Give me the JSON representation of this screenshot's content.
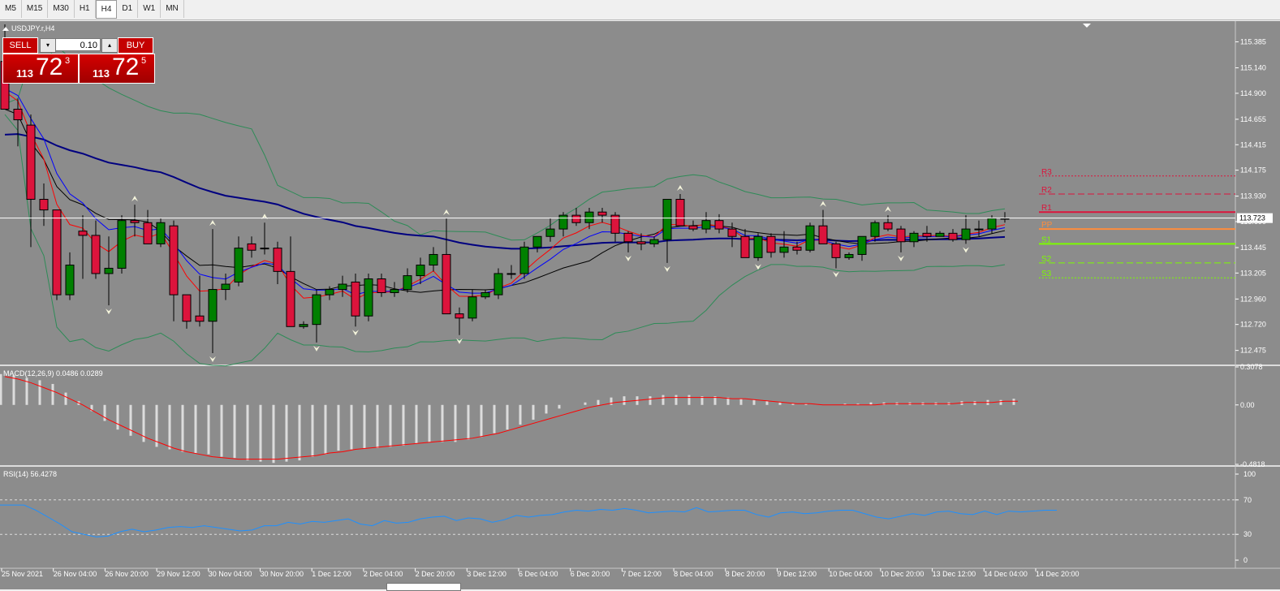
{
  "timeframes": [
    "M5",
    "M15",
    "M30",
    "H1",
    "H4",
    "D1",
    "W1",
    "MN"
  ],
  "active_timeframe": "H4",
  "symbol_label": "USDJPY.r,H4",
  "trade_panel": {
    "sell_label": "SELL",
    "buy_label": "BUY",
    "lot_value": "0.10",
    "sell_price_big": "113",
    "sell_price_pips": "72",
    "sell_price_frac": "3",
    "buy_price_big": "113",
    "buy_price_pips": "72",
    "buy_price_frac": "5"
  },
  "colors": {
    "background": "#8c8c8c",
    "bull": "#008000",
    "bear": "#dc143c",
    "ma_long": "#000080",
    "ma_mid": "#000000",
    "ma_fast_red": "#ff0000",
    "ma_fast_blue": "#0000ff",
    "bollinger": "#2e8b57",
    "macd_signal": "#ff0000",
    "rsi_line": "#1e90ff"
  },
  "chart_data": [
    {
      "type": "candlestick",
      "title": "USDJPY.r,H4",
      "ylim": [
        112.35,
        115.55
      ],
      "y_ticks": [
        "115.385",
        "115.140",
        "114.900",
        "114.655",
        "114.415",
        "114.175",
        "113.930",
        "113.690",
        "113.445",
        "113.205",
        "112.960",
        "112.720",
        "112.475"
      ],
      "current_price": "113.723",
      "x_tick_labels": [
        "25 Nov 2021",
        "26 Nov 04:00",
        "26 Nov 20:00",
        "29 Nov 12:00",
        "30 Nov 04:00",
        "30 Nov 20:00",
        "1 Dec 12:00",
        "2 Dec 04:00",
        "2 Dec 20:00",
        "3 Dec 12:00",
        "6 Dec 04:00",
        "6 Dec 20:00",
        "7 Dec 12:00",
        "8 Dec 04:00",
        "8 Dec 20:00",
        "9 Dec 12:00",
        "10 Dec 04:00",
        "10 Dec 20:00",
        "13 Dec 12:00",
        "14 Dec 04:00",
        "14 Dec 20:00"
      ],
      "candles": [
        {
          "o": 115.2,
          "h": 115.55,
          "l": 114.85,
          "c": 114.75
        },
        {
          "o": 114.75,
          "h": 114.85,
          "l": 114.4,
          "c": 114.65
        },
        {
          "o": 114.6,
          "h": 114.7,
          "l": 113.45,
          "c": 113.9
        },
        {
          "o": 113.9,
          "h": 114.05,
          "l": 113.65,
          "c": 113.8
        },
        {
          "o": 113.8,
          "h": 113.8,
          "l": 112.95,
          "c": 113.0
        },
        {
          "o": 113.0,
          "h": 113.4,
          "l": 112.95,
          "c": 113.28
        },
        {
          "o": 113.6,
          "h": 113.75,
          "l": 113.15,
          "c": 113.56
        },
        {
          "o": 113.56,
          "h": 113.7,
          "l": 113.15,
          "c": 113.2
        },
        {
          "o": 113.2,
          "h": 113.55,
          "l": 112.9,
          "c": 113.25
        },
        {
          "o": 113.25,
          "h": 113.75,
          "l": 113.2,
          "c": 113.7
        },
        {
          "o": 113.7,
          "h": 113.85,
          "l": 113.55,
          "c": 113.68
        },
        {
          "o": 113.68,
          "h": 113.8,
          "l": 113.48,
          "c": 113.48
        },
        {
          "o": 113.48,
          "h": 113.72,
          "l": 113.45,
          "c": 113.68
        },
        {
          "o": 113.65,
          "h": 113.7,
          "l": 112.75,
          "c": 113.0
        },
        {
          "o": 113.0,
          "h": 113.0,
          "l": 112.68,
          "c": 112.75
        },
        {
          "o": 112.8,
          "h": 113.18,
          "l": 112.7,
          "c": 112.75
        },
        {
          "o": 112.75,
          "h": 113.62,
          "l": 112.45,
          "c": 113.05
        },
        {
          "o": 113.05,
          "h": 113.2,
          "l": 112.95,
          "c": 113.1
        },
        {
          "o": 113.12,
          "h": 113.55,
          "l": 113.08,
          "c": 113.44
        },
        {
          "o": 113.48,
          "h": 113.55,
          "l": 113.35,
          "c": 113.42
        },
        {
          "o": 113.44,
          "h": 113.68,
          "l": 113.38,
          "c": 113.44
        },
        {
          "o": 113.44,
          "h": 113.5,
          "l": 113.1,
          "c": 113.22
        },
        {
          "o": 113.22,
          "h": 113.55,
          "l": 112.7,
          "c": 112.7
        },
        {
          "o": 112.7,
          "h": 112.75,
          "l": 112.68,
          "c": 112.72
        },
        {
          "o": 112.72,
          "h": 113.05,
          "l": 112.55,
          "c": 113.0
        },
        {
          "o": 113.0,
          "h": 113.08,
          "l": 112.95,
          "c": 113.05
        },
        {
          "o": 113.05,
          "h": 113.18,
          "l": 112.98,
          "c": 113.1
        },
        {
          "o": 113.12,
          "h": 113.2,
          "l": 112.7,
          "c": 112.8
        },
        {
          "o": 112.8,
          "h": 113.2,
          "l": 112.75,
          "c": 113.15
        },
        {
          "o": 113.15,
          "h": 113.2,
          "l": 112.98,
          "c": 113.02
        },
        {
          "o": 113.02,
          "h": 113.12,
          "l": 112.98,
          "c": 113.05
        },
        {
          "o": 113.05,
          "h": 113.25,
          "l": 113.02,
          "c": 113.18
        },
        {
          "o": 113.18,
          "h": 113.35,
          "l": 113.1,
          "c": 113.28
        },
        {
          "o": 113.28,
          "h": 113.45,
          "l": 113.22,
          "c": 113.38
        },
        {
          "o": 113.38,
          "h": 113.72,
          "l": 112.9,
          "c": 112.82
        },
        {
          "o": 112.82,
          "h": 112.88,
          "l": 112.62,
          "c": 112.78
        },
        {
          "o": 112.78,
          "h": 113.05,
          "l": 112.75,
          "c": 112.98
        },
        {
          "o": 112.98,
          "h": 113.05,
          "l": 112.96,
          "c": 113.02
        },
        {
          "o": 113.0,
          "h": 113.25,
          "l": 112.96,
          "c": 113.2
        },
        {
          "o": 113.2,
          "h": 113.28,
          "l": 113.15,
          "c": 113.2
        },
        {
          "o": 113.2,
          "h": 113.5,
          "l": 113.15,
          "c": 113.45
        },
        {
          "o": 113.45,
          "h": 113.55,
          "l": 113.4,
          "c": 113.55
        },
        {
          "o": 113.55,
          "h": 113.72,
          "l": 113.5,
          "c": 113.62
        },
        {
          "o": 113.62,
          "h": 113.78,
          "l": 113.55,
          "c": 113.75
        },
        {
          "o": 113.75,
          "h": 113.82,
          "l": 113.65,
          "c": 113.68
        },
        {
          "o": 113.68,
          "h": 113.82,
          "l": 113.62,
          "c": 113.78
        },
        {
          "o": 113.78,
          "h": 113.82,
          "l": 113.68,
          "c": 113.75
        },
        {
          "o": 113.75,
          "h": 113.78,
          "l": 113.5,
          "c": 113.58
        },
        {
          "o": 113.58,
          "h": 113.6,
          "l": 113.4,
          "c": 113.5
        },
        {
          "o": 113.5,
          "h": 113.58,
          "l": 113.42,
          "c": 113.48
        },
        {
          "o": 113.48,
          "h": 113.55,
          "l": 113.45,
          "c": 113.52
        },
        {
          "o": 113.52,
          "h": 113.9,
          "l": 113.3,
          "c": 113.9
        },
        {
          "o": 113.9,
          "h": 113.95,
          "l": 113.65,
          "c": 113.65
        },
        {
          "o": 113.65,
          "h": 113.7,
          "l": 113.6,
          "c": 113.62
        },
        {
          "o": 113.62,
          "h": 113.78,
          "l": 113.58,
          "c": 113.7
        },
        {
          "o": 113.7,
          "h": 113.76,
          "l": 113.58,
          "c": 113.62
        },
        {
          "o": 113.62,
          "h": 113.68,
          "l": 113.45,
          "c": 113.55
        },
        {
          "o": 113.55,
          "h": 113.62,
          "l": 113.4,
          "c": 113.35
        },
        {
          "o": 113.35,
          "h": 113.58,
          "l": 113.32,
          "c": 113.55
        },
        {
          "o": 113.55,
          "h": 113.58,
          "l": 113.35,
          "c": 113.4
        },
        {
          "o": 113.4,
          "h": 113.6,
          "l": 113.35,
          "c": 113.45
        },
        {
          "o": 113.45,
          "h": 113.5,
          "l": 113.38,
          "c": 113.42
        },
        {
          "o": 113.42,
          "h": 113.68,
          "l": 113.4,
          "c": 113.65
        },
        {
          "o": 113.65,
          "h": 113.8,
          "l": 113.48,
          "c": 113.48
        },
        {
          "o": 113.48,
          "h": 113.5,
          "l": 113.25,
          "c": 113.35
        },
        {
          "o": 113.35,
          "h": 113.4,
          "l": 113.33,
          "c": 113.38
        },
        {
          "o": 113.38,
          "h": 113.55,
          "l": 113.32,
          "c": 113.55
        },
        {
          "o": 113.55,
          "h": 113.7,
          "l": 113.5,
          "c": 113.68
        },
        {
          "o": 113.68,
          "h": 113.75,
          "l": 113.6,
          "c": 113.62
        },
        {
          "o": 113.62,
          "h": 113.65,
          "l": 113.4,
          "c": 113.5
        },
        {
          "o": 113.5,
          "h": 113.6,
          "l": 113.45,
          "c": 113.58
        },
        {
          "o": 113.58,
          "h": 113.65,
          "l": 113.5,
          "c": 113.55
        },
        {
          "o": 113.55,
          "h": 113.6,
          "l": 113.55,
          "c": 113.58
        },
        {
          "o": 113.58,
          "h": 113.62,
          "l": 113.5,
          "c": 113.52
        },
        {
          "o": 113.52,
          "h": 113.75,
          "l": 113.48,
          "c": 113.62
        },
        {
          "o": 113.62,
          "h": 113.7,
          "l": 113.55,
          "c": 113.62
        },
        {
          "o": 113.62,
          "h": 113.75,
          "l": 113.58,
          "c": 113.72
        },
        {
          "o": 113.72,
          "h": 113.78,
          "l": 113.68,
          "c": 113.72
        }
      ],
      "pivot_levels": [
        {
          "name": "R3",
          "value": 114.12
        },
        {
          "name": "R2",
          "value": 113.95
        },
        {
          "name": "R1",
          "value": 113.78
        },
        {
          "name": "PP",
          "value": 113.62
        },
        {
          "name": "S1",
          "value": 113.48
        },
        {
          "name": "S2",
          "value": 113.3
        },
        {
          "name": "S3",
          "value": 113.16
        }
      ]
    },
    {
      "type": "macd",
      "title": "MACD(12,26,9) 0.0486 0.0289",
      "ylim": [
        -0.4818,
        0.3078
      ],
      "y_ticks": [
        "0.3078",
        "0.00",
        "-0.4818"
      ],
      "histogram": [
        0.25,
        0.24,
        0.22,
        0.2,
        0.17,
        0.1,
        0.03,
        -0.05,
        -0.13,
        -0.2,
        -0.25,
        -0.3,
        -0.34,
        -0.36,
        -0.38,
        -0.39,
        -0.4,
        -0.42,
        -0.43,
        -0.45,
        -0.46,
        -0.47,
        -0.46,
        -0.45,
        -0.42,
        -0.4,
        -0.37,
        -0.36,
        -0.35,
        -0.35,
        -0.34,
        -0.33,
        -0.31,
        -0.3,
        -0.3,
        -0.3,
        -0.28,
        -0.26,
        -0.23,
        -0.2,
        -0.16,
        -0.12,
        -0.07,
        -0.03,
        0.0,
        0.02,
        0.04,
        0.06,
        0.07,
        0.07,
        0.07,
        0.08,
        0.08,
        0.08,
        0.07,
        0.07,
        0.06,
        0.05,
        0.04,
        0.03,
        0.02,
        0.01,
        0.01,
        0.0,
        0.0,
        0.01,
        0.01,
        0.02,
        0.02,
        0.02,
        0.02,
        0.02,
        0.02,
        0.02,
        0.03,
        0.03,
        0.04,
        0.04,
        0.05
      ],
      "signal": [
        0.23,
        0.21,
        0.18,
        0.14,
        0.1,
        0.05,
        0.0,
        -0.06,
        -0.12,
        -0.17,
        -0.22,
        -0.27,
        -0.31,
        -0.35,
        -0.38,
        -0.4,
        -0.42,
        -0.43,
        -0.44,
        -0.44,
        -0.44,
        -0.44,
        -0.43,
        -0.42,
        -0.41,
        -0.39,
        -0.38,
        -0.36,
        -0.35,
        -0.34,
        -0.33,
        -0.32,
        -0.31,
        -0.3,
        -0.29,
        -0.28,
        -0.27,
        -0.25,
        -0.23,
        -0.2,
        -0.17,
        -0.14,
        -0.11,
        -0.08,
        -0.05,
        -0.02,
        0.0,
        0.02,
        0.03,
        0.04,
        0.05,
        0.06,
        0.06,
        0.06,
        0.06,
        0.06,
        0.05,
        0.05,
        0.04,
        0.03,
        0.02,
        0.01,
        0.01,
        0.0,
        0.0,
        0.0,
        0.0,
        0.0,
        0.01,
        0.01,
        0.01,
        0.01,
        0.01,
        0.01,
        0.02,
        0.02,
        0.02,
        0.03,
        0.03
      ]
    },
    {
      "type": "line",
      "title": "RSI(14) 56.4278",
      "ylim": [
        0,
        100
      ],
      "y_ticks": [
        "100",
        "70",
        "30",
        "0"
      ],
      "levels": [
        70,
        30
      ],
      "values": [
        64,
        64,
        64,
        58,
        50,
        42,
        33,
        30,
        27,
        28,
        33,
        36,
        33,
        35,
        38,
        39,
        38,
        40,
        38,
        36,
        34,
        35,
        40,
        40,
        44,
        42,
        45,
        44,
        46,
        48,
        42,
        40,
        46,
        43,
        44,
        48,
        50,
        51,
        46,
        49,
        48,
        44,
        47,
        52,
        50,
        52,
        53,
        56,
        58,
        57,
        59,
        58,
        60,
        58,
        55,
        56,
        57,
        56,
        61,
        56,
        57,
        58,
        58,
        53,
        50,
        55,
        56,
        54,
        55,
        57,
        58,
        58,
        54,
        50,
        48,
        51,
        54,
        52,
        56,
        57,
        54,
        53,
        57,
        53,
        57,
        56,
        57,
        58,
        58
      ]
    }
  ]
}
